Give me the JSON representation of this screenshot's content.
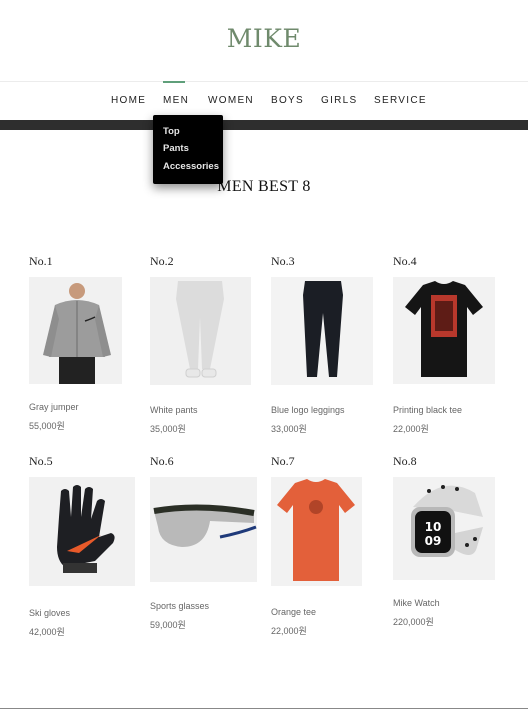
{
  "brand": {
    "logo": "MIKE"
  },
  "nav": {
    "items": [
      {
        "label": "HOME"
      },
      {
        "label": "MEN"
      },
      {
        "label": "WOMEN"
      },
      {
        "label": "BOYS"
      },
      {
        "label": "GIRLS"
      },
      {
        "label": "SERVICE"
      }
    ],
    "active": "MEN",
    "dropdown": [
      "Top",
      "Pants",
      "Accessories"
    ]
  },
  "section": {
    "title": "MEN BEST 8"
  },
  "products": [
    {
      "rank": "No.1",
      "name": "Gray jumper",
      "price": "55,000원",
      "icon": "gray-jumper-image"
    },
    {
      "rank": "No.2",
      "name": "White pants",
      "price": "35,000원",
      "icon": "white-pants-image"
    },
    {
      "rank": "No.3",
      "name": "Blue logo leggings",
      "price": "33,000원",
      "icon": "leggings-image"
    },
    {
      "rank": "No.4",
      "name": "Printing black tee",
      "price": "22,000원",
      "icon": "black-tee-image"
    },
    {
      "rank": "No.5",
      "name": "Ski gloves",
      "price": "42,000원",
      "icon": "gloves-image"
    },
    {
      "rank": "No.6",
      "name": "Sports glasses",
      "price": "59,000원",
      "icon": "glasses-image"
    },
    {
      "rank": "No.7",
      "name": "Orange tee",
      "price": "22,000원",
      "icon": "orange-tee-image"
    },
    {
      "rank": "No.8",
      "name": "Mike Watch",
      "price": "220,000원",
      "icon": "watch-image"
    }
  ],
  "colors": {
    "logo": "#6f8a6c",
    "active_underline": "#5f9f7a",
    "band": "#2e2e2e"
  }
}
